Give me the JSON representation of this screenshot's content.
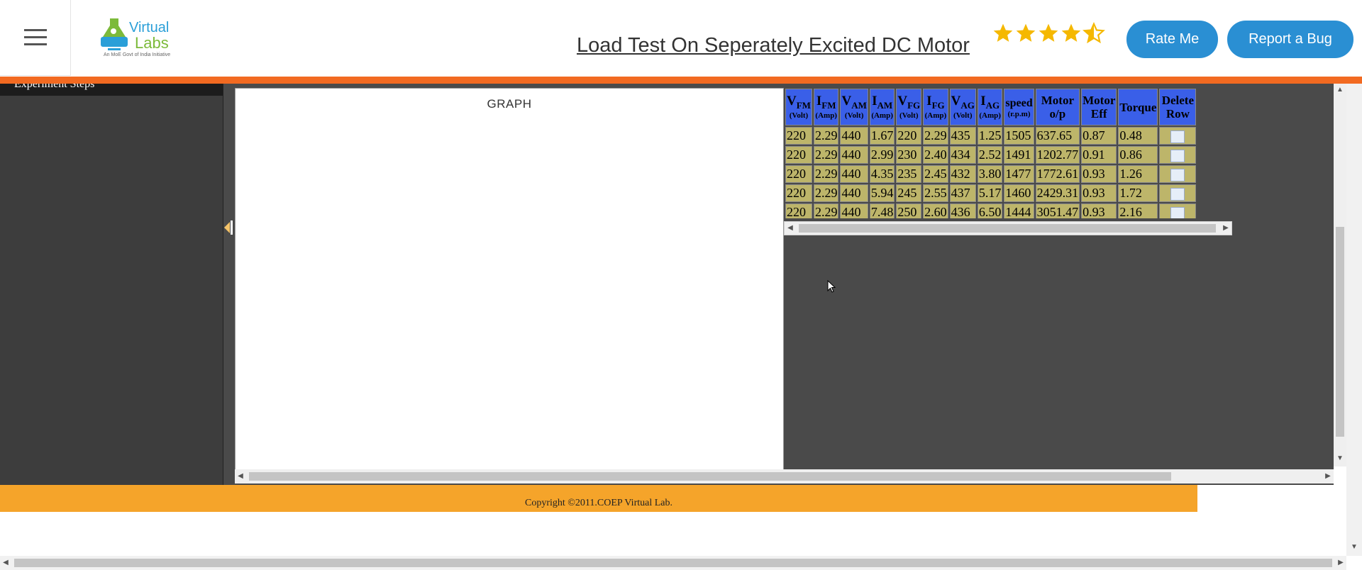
{
  "header": {
    "title": "Load Test On Seperately Excited DC Motor",
    "rating": 4.5,
    "rate_label": "Rate Me",
    "bug_label": "Report a Bug",
    "logo": {
      "line1": "Virtual",
      "line2": "Labs",
      "tagline": "An MoE Govt of India Initiative"
    }
  },
  "sidebar": {
    "top_text": "Experiment Steps"
  },
  "graph": {
    "label": "GRAPH"
  },
  "table": {
    "headers": [
      {
        "main": "V",
        "sub": "FM",
        "unit": "(Volt)"
      },
      {
        "main": "I",
        "sub": "FM",
        "unit": "(Amp)"
      },
      {
        "main": "V",
        "sub": "AM",
        "unit": "(Volt)"
      },
      {
        "main": "I",
        "sub": "AM",
        "unit": "(Amp)"
      },
      {
        "main": "V",
        "sub": "FG",
        "unit": "(Volt)"
      },
      {
        "main": "I",
        "sub": "FG",
        "unit": "(Amp)"
      },
      {
        "main": "V",
        "sub": "AG",
        "unit": "(Volt)"
      },
      {
        "main": "I",
        "sub": "AG",
        "unit": "(Amp)"
      },
      {
        "main": "speed",
        "sub": "",
        "unit": "(r.p.m)"
      },
      {
        "main": "Motor",
        "sub": "",
        "unit": "o/p"
      },
      {
        "main": "Motor",
        "sub": "",
        "unit": "Eff"
      },
      {
        "main": "Torque",
        "sub": "",
        "unit": ""
      },
      {
        "main": "Delete",
        "sub": "",
        "unit": "Row"
      }
    ],
    "rows": [
      [
        "220",
        "2.29",
        "440",
        "1.67",
        "220",
        "2.29",
        "435",
        "1.25",
        "1505",
        "637.65",
        "0.87",
        "0.48"
      ],
      [
        "220",
        "2.29",
        "440",
        "2.99",
        "230",
        "2.40",
        "434",
        "2.52",
        "1491",
        "1202.77",
        "0.91",
        "0.86"
      ],
      [
        "220",
        "2.29",
        "440",
        "4.35",
        "235",
        "2.45",
        "432",
        "3.80",
        "1477",
        "1772.61",
        "0.93",
        "1.26"
      ],
      [
        "220",
        "2.29",
        "440",
        "5.94",
        "245",
        "2.55",
        "437",
        "5.17",
        "1460",
        "2429.31",
        "0.93",
        "1.72"
      ],
      [
        "220",
        "2.29",
        "440",
        "7.48",
        "250",
        "2.60",
        "436",
        "6.50",
        "1444",
        "3051.47",
        "0.93",
        "2.16"
      ]
    ]
  },
  "footer": {
    "copyright": "Copyright ©2011.COEP Virtual Lab."
  },
  "colors": {
    "header_bar": "#f26a21",
    "footer": "#f5a42a",
    "button": "#2a8fd3",
    "table_header": "#3a5fe8",
    "table_cell": "#bdb56a"
  }
}
